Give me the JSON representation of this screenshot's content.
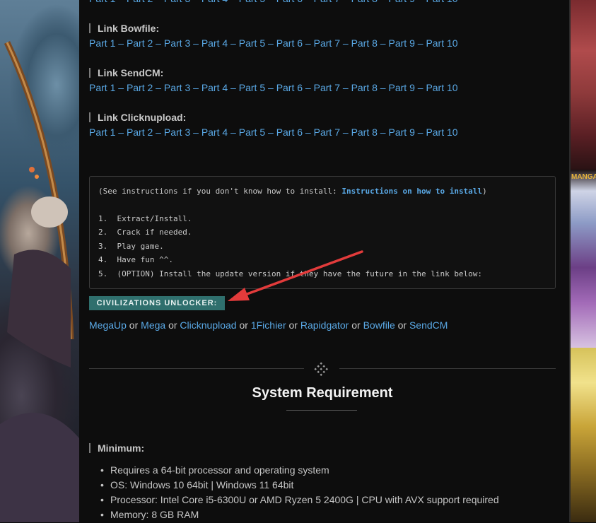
{
  "parts": [
    "Part 1",
    "Part 2",
    "Part 3",
    "Part 4",
    "Part 5",
    "Part 6",
    "Part 7",
    "Part 8",
    "Part 9",
    "Part 10"
  ],
  "separator": "–",
  "link_groups": [
    {
      "heading": "Link Bowfile:"
    },
    {
      "heading": "Link SendCM:"
    },
    {
      "heading": "Link Clicknupload:"
    }
  ],
  "instructions": {
    "prefix": "(See instructions if you don't know how to install: ",
    "link": "Instructions on how to install",
    "suffix": ")",
    "steps": [
      "1.  Extract/Install.",
      "2.  Crack if needed.",
      "3.  Play game.",
      "4.  Have fun ^^.",
      "5.  (OPTION) Install the update version if they have the future in the link below:"
    ]
  },
  "unlocker": {
    "badge": "CIVILIZATIONS UNLOCKER:",
    "mirrors": [
      "MegaUp",
      "Mega",
      "Clicknupload",
      "1Fichier",
      "Rapidgator",
      "Bowfile",
      "SendCM"
    ],
    "or": "or"
  },
  "system": {
    "title": "System Requirement",
    "minimum_heading": "Minimum:",
    "items": [
      "Requires a 64-bit processor and operating system",
      "OS: Windows 10 64bit | Windows 11 64bit",
      "Processor: Intel Core i5-6300U or AMD Ryzen 5 2400G | CPU with AVX support required",
      "Memory: 8 GB RAM"
    ]
  },
  "sidebar_ad_logo": "MANGA",
  "colors": {
    "link": "#5aa9e6",
    "badge_bg": "#2f6f6d",
    "arrow": "#e23b3b"
  }
}
